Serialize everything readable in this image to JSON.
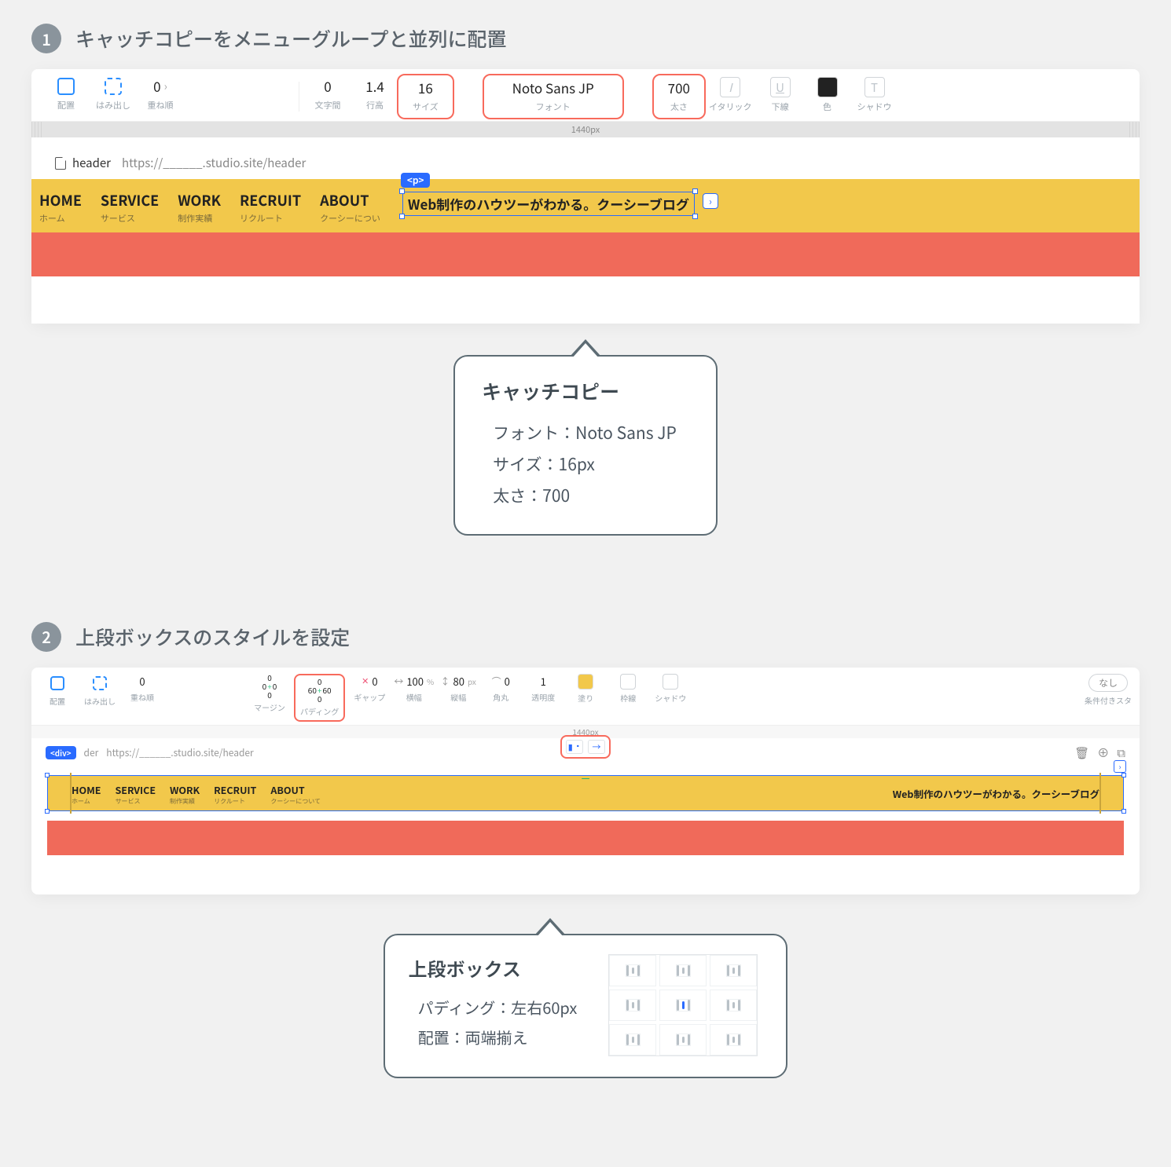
{
  "step1": {
    "num": "1",
    "title": "キャッチコピーをメニューグループと並列に配置",
    "toolbar": {
      "align_lbl": "配置",
      "overflow_lbl": "はみ出し",
      "zindex_val": "0",
      "zindex_lbl": "重ね順",
      "letter_val": "0",
      "letter_lbl": "文字間",
      "line_val": "1.4",
      "line_lbl": "行高",
      "size_val": "16",
      "size_lbl": "サイズ",
      "font_val": "Noto Sans JP",
      "font_lbl": "フォント",
      "weight_val": "700",
      "weight_lbl": "太さ",
      "italic_lbl": "イタリック",
      "italic_glyph": "I",
      "underline_lbl": "下線",
      "underline_glyph": "U",
      "color_lbl": "色",
      "shadow_lbl": "シャドウ",
      "shadow_glyph": "T"
    },
    "ruler": "1440px",
    "addr": {
      "page": "header",
      "url": "https://______.studio.site/header"
    },
    "menus": [
      {
        "en": "HOME",
        "jp": "ホーム"
      },
      {
        "en": "SERVICE",
        "jp": "サービス"
      },
      {
        "en": "WORK",
        "jp": "制作実績"
      },
      {
        "en": "RECRUIT",
        "jp": "リクルート"
      },
      {
        "en": "ABOUT",
        "jp": "クーシーについ"
      }
    ],
    "tag": "<p>",
    "catch": "Web制作のハウツーがわかる。クーシーブログ",
    "tip": {
      "title": "キャッチコピー",
      "l1": "フォント：Noto Sans JP",
      "l2": "サイズ：16px",
      "l3": "太さ：700"
    }
  },
  "step2": {
    "num": "2",
    "title": "上段ボックスのスタイルを設定",
    "toolbar": {
      "align_lbl": "配置",
      "overflow_lbl": "はみ出し",
      "zindex_val": "0",
      "zindex_lbl": "重ね順",
      "margin_t": "0",
      "margin_r": "0",
      "margin_b": "0",
      "margin_l": "0",
      "margin_lbl": "マージン",
      "pad_t": "0",
      "pad_r": "60",
      "pad_b": "0",
      "pad_l": "60",
      "pad_lbl": "パディング",
      "gap_val": "0",
      "gap_lbl": "ギャップ",
      "gap_glyph": "✕",
      "w_val": "100",
      "w_unit": "%",
      "w_lbl": "横幅",
      "w_glyph": "↔",
      "h_val": "80",
      "h_unit": "px",
      "h_lbl": "縦幅",
      "h_glyph": "↕",
      "radius_val": "0",
      "radius_lbl": "角丸",
      "radius_glyph": "⌒",
      "opacity_val": "1",
      "opacity_lbl": "透明度",
      "fill_lbl": "塗り",
      "stroke_lbl": "枠線",
      "shadow_lbl": "シャドウ",
      "none": "なし",
      "cond_lbl": "条件付きスタ"
    },
    "ruler": "1440px",
    "addr": {
      "tag": "<div>",
      "page": "der",
      "url": "https://______.studio.site/header"
    },
    "menus": [
      {
        "en": "HOME",
        "jp": "ホーム"
      },
      {
        "en": "SERVICE",
        "jp": "サービス"
      },
      {
        "en": "WORK",
        "jp": "制作実績"
      },
      {
        "en": "RECRUIT",
        "jp": "リクルート"
      },
      {
        "en": "ABOUT",
        "jp": "クーシーについて"
      }
    ],
    "catch": "Web制作のハウツーがわかる。クーシーブログ",
    "tip": {
      "title": "上段ボックス",
      "l1": "パディング：左右60px",
      "l2": "配置：両端揃え"
    },
    "align_btn1": "▮ ▪",
    "align_btn2": "→"
  }
}
